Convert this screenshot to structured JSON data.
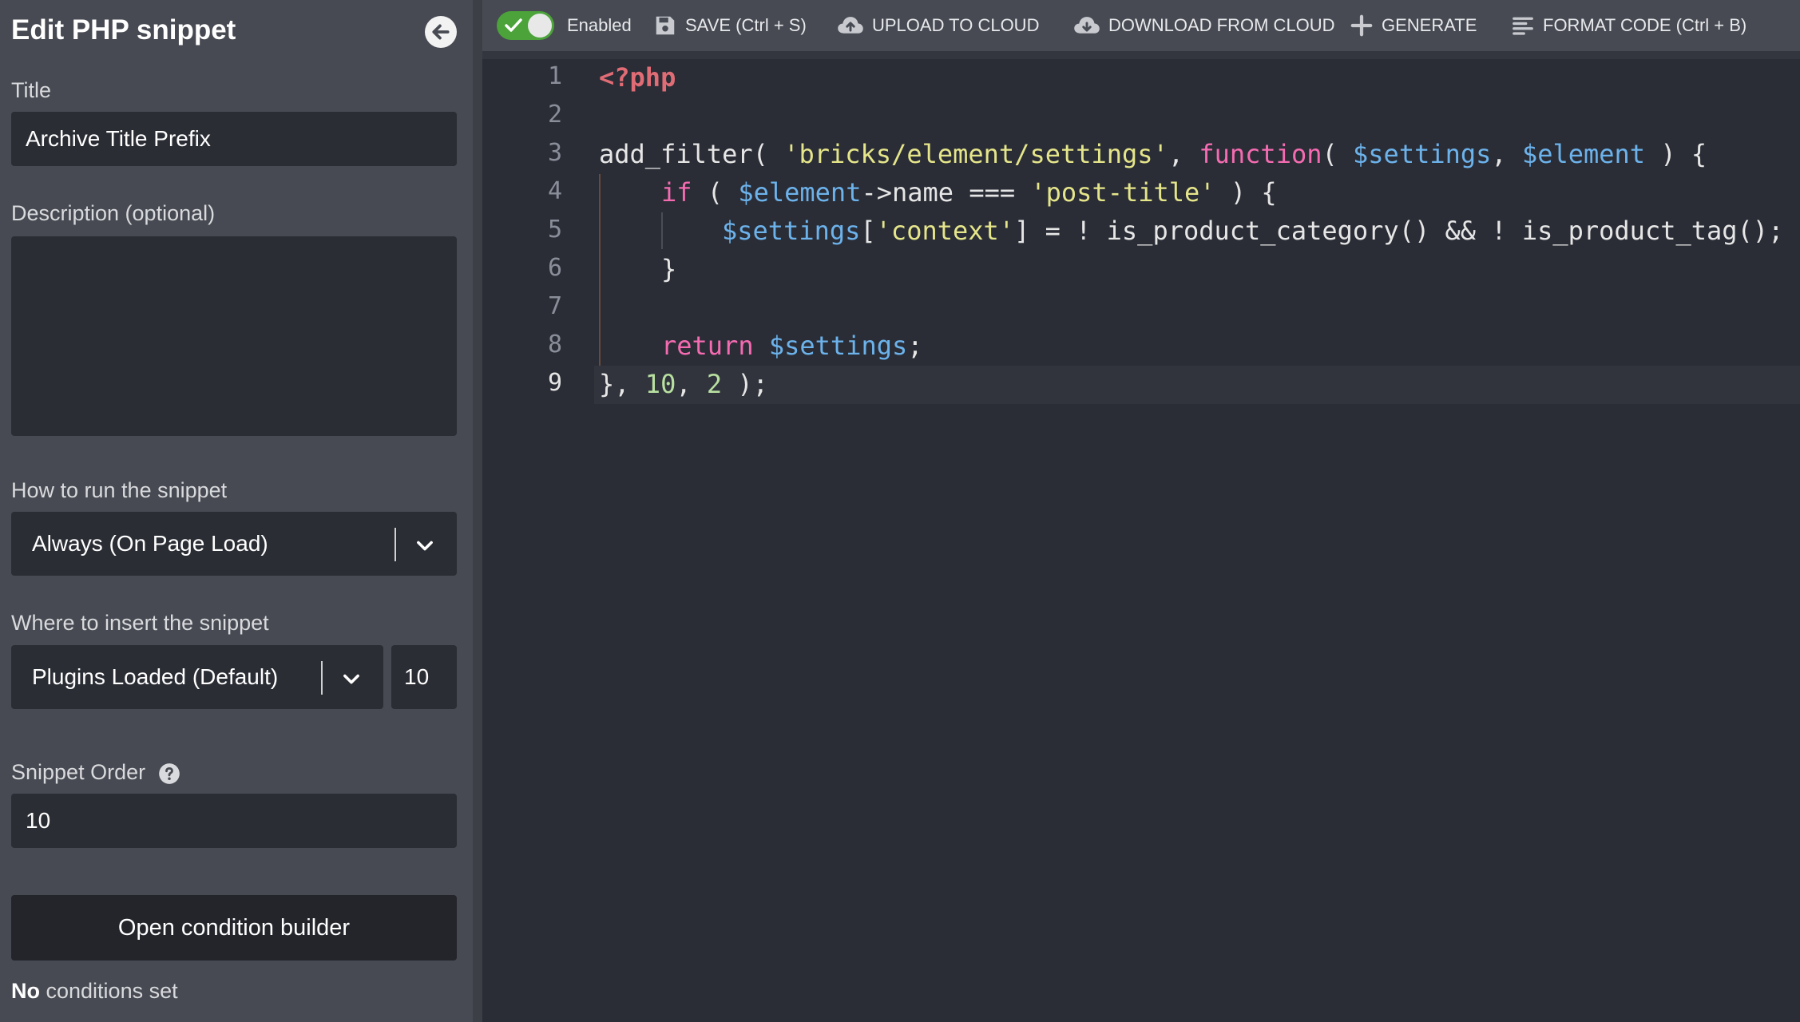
{
  "panel": {
    "title": "Edit PHP snippet",
    "title_label": "Title",
    "title_value": "Archive Title Prefix",
    "description_label": "Description (optional)",
    "description_value": "",
    "run_label": "How to run the snippet",
    "run_value": "Always (On Page Load)",
    "insert_label": "Where to insert the snippet",
    "insert_value": "Plugins Loaded (Default)",
    "insert_priority": "10",
    "order_label": "Snippet Order",
    "order_value": "10",
    "condition_button": "Open condition builder",
    "condition_status_bold": "No",
    "condition_status_rest": " conditions set"
  },
  "toolbar": {
    "enabled_label": "Enabled",
    "enabled": true,
    "save_label": "SAVE (Ctrl + S)",
    "upload_label": "UPLOAD TO CLOUD",
    "download_label": "DOWNLOAD FROM CLOUD",
    "generate_label": "GENERATE",
    "format_label": "FORMAT CODE (Ctrl + B)"
  },
  "editor": {
    "line_numbers": [
      "1",
      "2",
      "3",
      "4",
      "5",
      "6",
      "7",
      "8",
      "9"
    ],
    "active_line": 9,
    "code": {
      "l1_php": "<?php",
      "l3_a": "add_filter( ",
      "l3_str": "'bricks/element/settings'",
      "l3_b": ", ",
      "l3_kw": "function",
      "l3_c": "( ",
      "l3_var1": "$settings",
      "l3_d": ", ",
      "l3_var2": "$element",
      "l3_e": " ) {",
      "l4_kw": "if",
      "l4_a": " ( ",
      "l4_var": "$element",
      "l4_b": "->name === ",
      "l4_str": "'post-title'",
      "l4_c": " ) {",
      "l5_var": "$settings",
      "l5_a": "[",
      "l5_str": "'context'",
      "l5_b": "] = ! is_product_category() && ! is_product_tag();",
      "l6": "}",
      "l8_kw": "return",
      "l8_a": " ",
      "l8_var": "$settings",
      "l8_b": ";",
      "l9_a": "}, ",
      "l9_n1": "10",
      "l9_b": ", ",
      "l9_n2": "2",
      "l9_c": " );"
    }
  },
  "colors": {
    "accent_toggle": "#4ba33a",
    "php_tag": "#e06c75",
    "string": "#e5e58a",
    "keyword": "#f56bb1",
    "variable": "#6cb2eb",
    "number": "#b8e0a0"
  },
  "icons": [
    "back-arrow-icon",
    "chevron-down-icon",
    "help-circle-icon",
    "check-icon",
    "floppy-save-icon",
    "cloud-upload-icon",
    "cloud-download-icon",
    "plus-icon",
    "align-left-icon"
  ]
}
